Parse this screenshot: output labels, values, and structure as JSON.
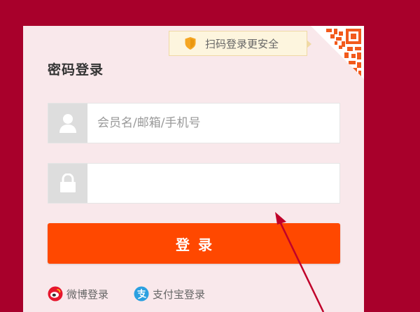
{
  "login": {
    "title": "密码登录",
    "qr_tip": "扫码登录更安全",
    "username": {
      "placeholder": "会员名/邮箱/手机号",
      "value": ""
    },
    "password": {
      "placeholder": "",
      "value": ""
    },
    "submit_label": "登录",
    "alt_logins": [
      {
        "label": "微博登录",
        "icon": "weibo-icon"
      },
      {
        "label": "支付宝登录",
        "icon": "alipay-icon"
      }
    ]
  },
  "colors": {
    "page_background": "#a8002b",
    "panel_background": "#f9e8eb",
    "primary_button": "#ff4800",
    "tip_background": "#fdf5de",
    "annotation_arrow": "#c0002a"
  }
}
